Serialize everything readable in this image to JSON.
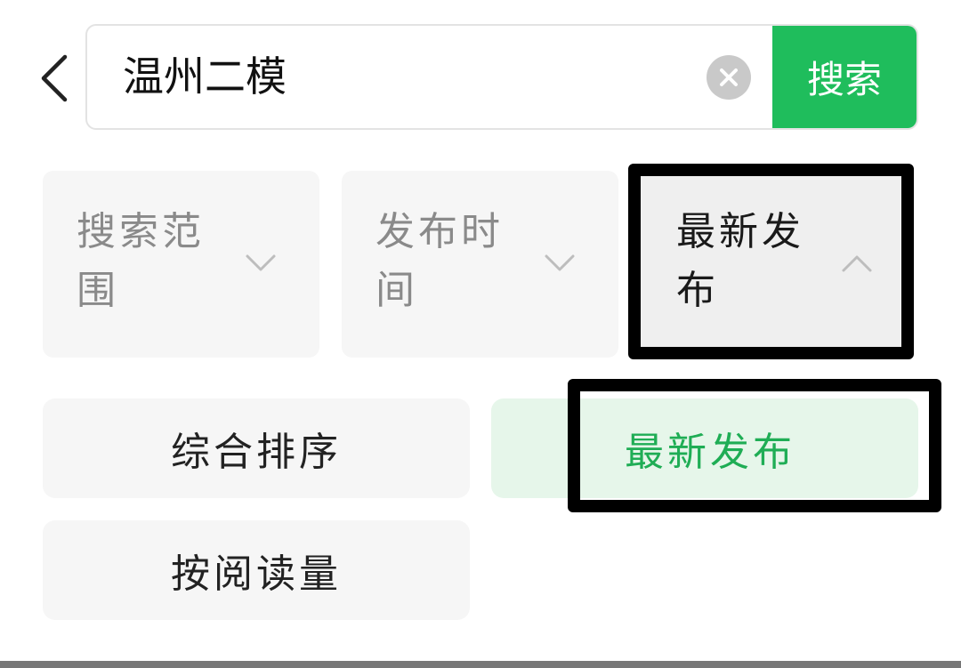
{
  "search": {
    "query": "温州二模",
    "button_label": "搜索"
  },
  "filters": {
    "scope": {
      "label": "搜索范围"
    },
    "time": {
      "label": "发布时间"
    },
    "latest": {
      "label": "最新发布",
      "expanded": true
    }
  },
  "sort_options": [
    {
      "label": "综合排序",
      "selected": false
    },
    {
      "label": "最新发布",
      "selected": true
    },
    {
      "label": "按阅读量",
      "selected": false
    }
  ],
  "colors": {
    "accent": "#1fbd5c",
    "selected_bg": "#e6f6ea",
    "selected_text": "#1fad55",
    "tab_bg": "#f6f6f6",
    "muted_text": "#8a8a8a"
  },
  "icons": {
    "back": "chevron-left-icon",
    "clear": "close-circle-icon",
    "collapsed": "chevron-down-icon",
    "expanded": "chevron-up-icon"
  }
}
